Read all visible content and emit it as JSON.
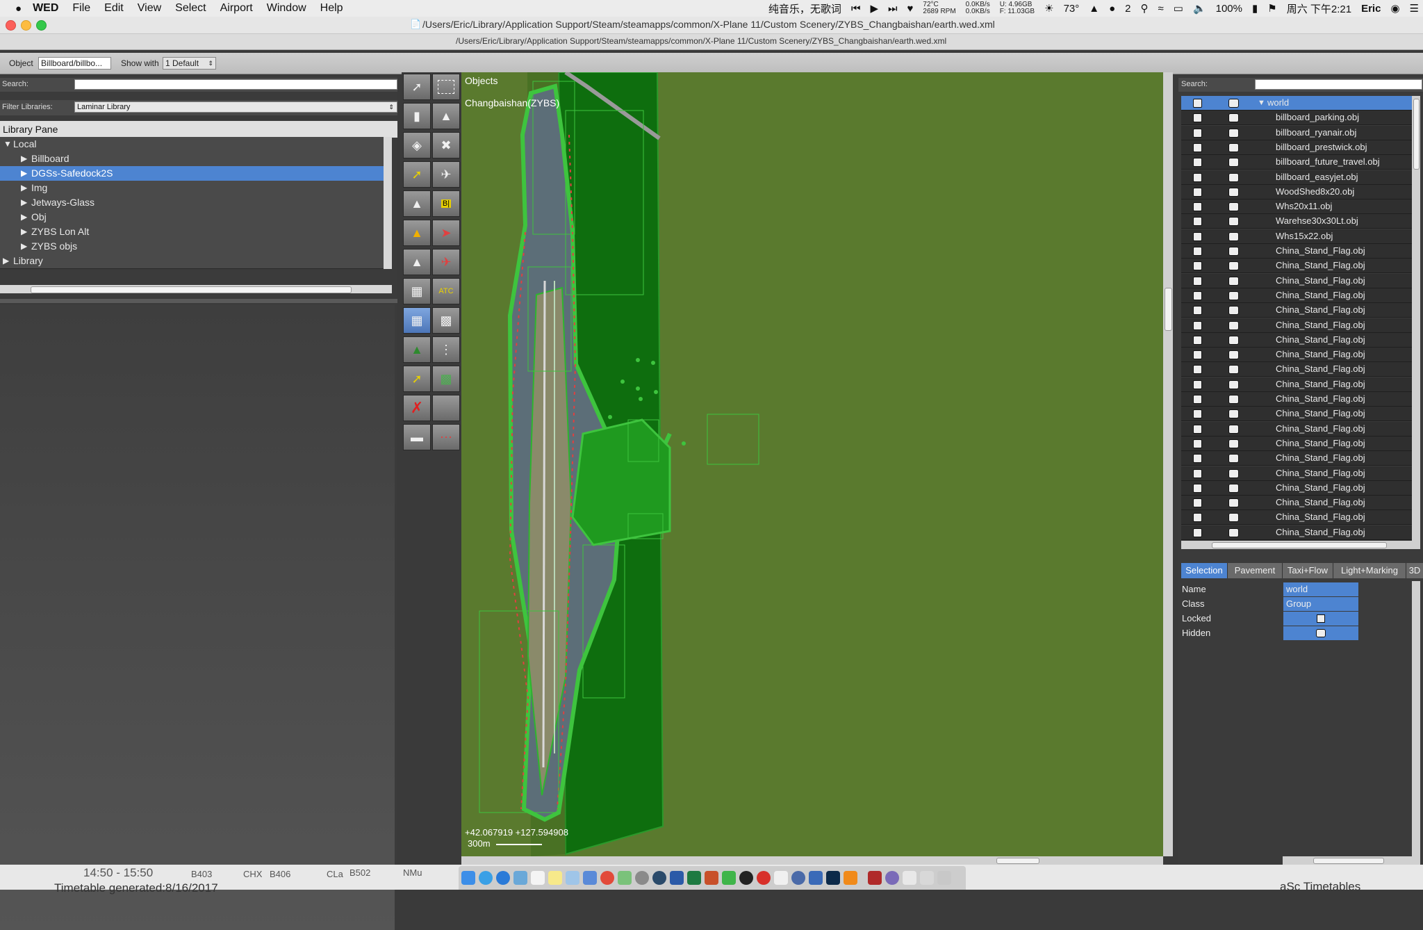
{
  "menubar": {
    "app_name": "WED",
    "menus": [
      "File",
      "Edit",
      "View",
      "Select",
      "Airport",
      "Window",
      "Help"
    ],
    "now_playing": "纯音乐，无歌词",
    "cpu_temp": "72°C",
    "fan_rpm": "2689 RPM",
    "net_up": "0.0KB/s",
    "net_down": "0.0KB/s",
    "mem_used": "U: 4.96GB",
    "mem_free": "F: 11.03GB",
    "weather": "73°",
    "wechat_count": "2",
    "battery": "100%",
    "clock": "周六 下午2:21",
    "user": "Eric"
  },
  "window": {
    "title_path": "/Users/Eric/Library/Application Support/Steam/steamapps/common/X-Plane 11/Custom Scenery/ZYBS_Changbaishan/earth.wed.xml",
    "subtitle_path": "/Users/Eric/Library/Application Support/Steam/steamapps/common/X-Plane 11/Custom Scenery/ZYBS_Changbaishan/earth.wed.xml"
  },
  "toolbar": {
    "object_label": "Object",
    "object_value": "Billboard/billbo...",
    "show_with_label": "Show with",
    "show_with_value": "1 Default"
  },
  "library": {
    "search_label": "Search:",
    "filter_label": "Filter Libraries:",
    "filter_value": "Laminar Library",
    "pane_title": "Library Pane",
    "tree": [
      {
        "label": "Local",
        "expanded": true,
        "depth": 0
      },
      {
        "label": "Billboard",
        "expanded": false,
        "depth": 1
      },
      {
        "label": "DGSs-Safedock2S",
        "expanded": false,
        "depth": 1,
        "selected": true
      },
      {
        "label": "Img",
        "expanded": false,
        "depth": 1
      },
      {
        "label": "Jetways-Glass",
        "expanded": false,
        "depth": 1
      },
      {
        "label": "Obj",
        "expanded": false,
        "depth": 1
      },
      {
        "label": "ZYBS Lon Alt",
        "expanded": false,
        "depth": 1
      },
      {
        "label": "ZYBS objs",
        "expanded": false,
        "depth": 1
      },
      {
        "label": "Library",
        "expanded": false,
        "depth": 0
      }
    ]
  },
  "map": {
    "layer_label": "Objects",
    "airport_label": "Changbaishan(ZYBS)",
    "coords": "+42.067919 +127.594908",
    "scale": "300m"
  },
  "hierarchy": {
    "search_label": "Search:",
    "items": [
      "world",
      "billboard_parking.obj",
      "billboard_ryanair.obj",
      "billboard_prestwick.obj",
      "billboard_future_travel.obj",
      "billboard_easyjet.obj",
      "WoodShed8x20.obj",
      "Whs20x11.obj",
      "Warehse30x30Lt.obj",
      "Whs15x22.obj",
      "China_Stand_Flag.obj",
      "China_Stand_Flag.obj",
      "China_Stand_Flag.obj",
      "China_Stand_Flag.obj",
      "China_Stand_Flag.obj",
      "China_Stand_Flag.obj",
      "China_Stand_Flag.obj",
      "China_Stand_Flag.obj",
      "China_Stand_Flag.obj",
      "China_Stand_Flag.obj",
      "China_Stand_Flag.obj",
      "China_Stand_Flag.obj",
      "China_Stand_Flag.obj",
      "China_Stand_Flag.obj",
      "China_Stand_Flag.obj",
      "China_Stand_Flag.obj",
      "China_Stand_Flag.obj",
      "China_Stand_Flag.obj",
      "China_Stand_Flag.obj",
      "China_Stand_Flag.obj"
    ]
  },
  "tabs": [
    "Selection",
    "Pavement",
    "Taxi+Flow",
    "Light+Marking",
    "3D"
  ],
  "properties": [
    {
      "name": "Name",
      "value": "world"
    },
    {
      "name": "Class",
      "value": "Group"
    },
    {
      "name": "Locked",
      "value": ""
    },
    {
      "name": "Hidden",
      "value": ""
    }
  ],
  "background_text": {
    "time_range": "14:50 - 15:50",
    "codes": [
      "B403",
      "CHX",
      "B406",
      "CLa",
      "B502",
      "NMu"
    ],
    "timetable": "Timetable generated:8/16/2017",
    "brand": "aSc Timetables"
  },
  "colors": {
    "selection_blue": "#4d84d1",
    "boundary_green": "#1f7a12",
    "overlay_green": "#3ec43e"
  }
}
